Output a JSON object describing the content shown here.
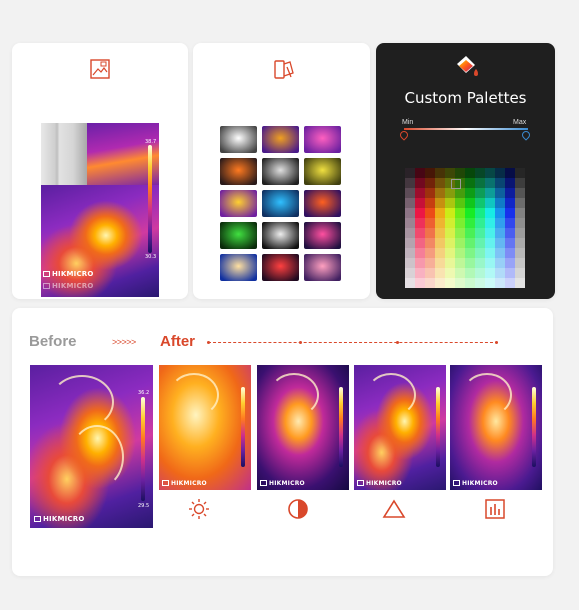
{
  "custom_palettes": {
    "title": "Custom Palettes",
    "slider_min": "Min",
    "slider_max": "Max"
  },
  "comparison": {
    "before_label": "Before",
    "arrows": ">>>>>",
    "after_label": "After"
  },
  "brand": "HIKMICRO",
  "before_scale": {
    "max": "36.2",
    "min": "29.5"
  },
  "top_scale": {
    "max": "38.7",
    "min": "30.3"
  },
  "after_scale": {
    "max": "36.6",
    "min": "29.6"
  },
  "icons": [
    "image-icon",
    "palette-swatch-icon",
    "paint-bucket-icon",
    "brightness-icon",
    "contrast-icon",
    "triangle-icon",
    "histogram-icon"
  ],
  "colors": {
    "accent": "#d9482b",
    "dark_card": "#1f1f1f",
    "muted": "#9a9a9a"
  }
}
